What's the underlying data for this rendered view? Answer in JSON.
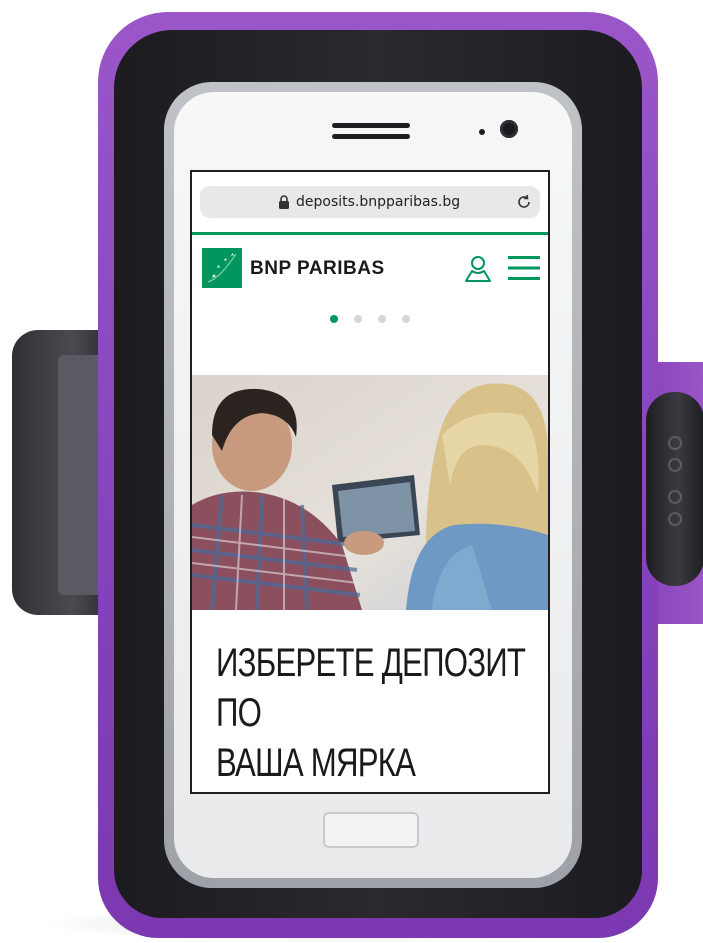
{
  "browser": {
    "url": "deposits.bnpparibas.bg",
    "lock_icon": "lock-icon",
    "reload_icon": "reload-icon"
  },
  "site_header": {
    "brand_name": "BNP PARIBAS",
    "logo_icon": "bnp-stars-logo",
    "account_icon": "user-icon",
    "menu_icon": "hamburger-menu-icon",
    "accent_color": "#00965e"
  },
  "carousel": {
    "slide_count": 4,
    "active_index": 0,
    "active_color": "#00965e",
    "inactive_color": "#d6d6d8"
  },
  "hero": {
    "headline_line1": "ИЗБЕРЕТЕ ДЕПОЗИТ ПО",
    "headline_line2": "ВАША МЯРКА"
  },
  "device": {
    "armband_color": "#8a44bd"
  }
}
